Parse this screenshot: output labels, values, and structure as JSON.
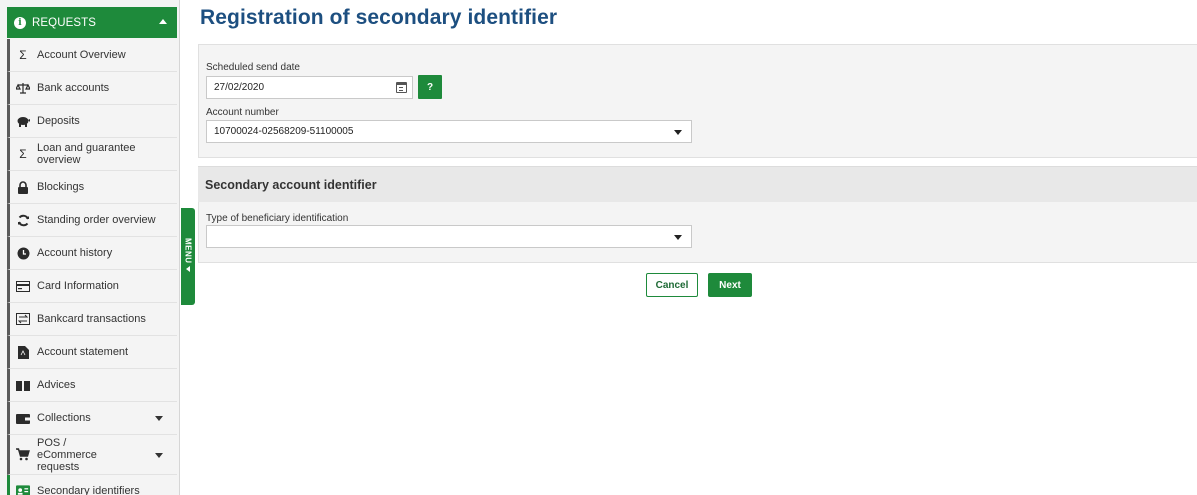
{
  "sidebar": {
    "header_label": "REQUESTS",
    "items": [
      {
        "label": "Account Overview",
        "icon": "sigma-icon"
      },
      {
        "label": "Bank accounts",
        "icon": "scales-icon"
      },
      {
        "label": "Deposits",
        "icon": "piggy-bank-icon"
      },
      {
        "label": "Loan and guarantee overview",
        "icon": "sigma-icon"
      },
      {
        "label": "Blockings",
        "icon": "lock-icon"
      },
      {
        "label": "Standing order overview",
        "icon": "refresh-icon"
      },
      {
        "label": "Account history",
        "icon": "clock-icon"
      },
      {
        "label": "Card Information",
        "icon": "card-icon"
      },
      {
        "label": "Bankcard transactions",
        "icon": "transfer-icon"
      },
      {
        "label": "Account statement",
        "icon": "document-icon"
      },
      {
        "label": "Advices",
        "icon": "book-icon"
      },
      {
        "label": "Collections",
        "icon": "wallet-icon"
      },
      {
        "label": "POS / eCommerce requests",
        "icon": "cart-icon"
      },
      {
        "label": "Secondary identifiers",
        "icon": "id-card-icon"
      }
    ],
    "menu_toggle_label": "MENU"
  },
  "main": {
    "title": "Registration of secondary identifier",
    "scheduled_send_date": {
      "label": "Scheduled send date",
      "value": "27/02/2020"
    },
    "help_label": "?",
    "account_number": {
      "label": "Account number",
      "value": "10700024-02568209-51100005"
    },
    "section_title": "Secondary account identifier",
    "beneficiary_identification": {
      "label": "Type of beneficiary identification",
      "value": ""
    },
    "cancel_label": "Cancel",
    "next_label": "Next"
  },
  "colors": {
    "accent": "#1e8a3b",
    "title": "#1d4f80",
    "panel": "#f4f4f4"
  }
}
